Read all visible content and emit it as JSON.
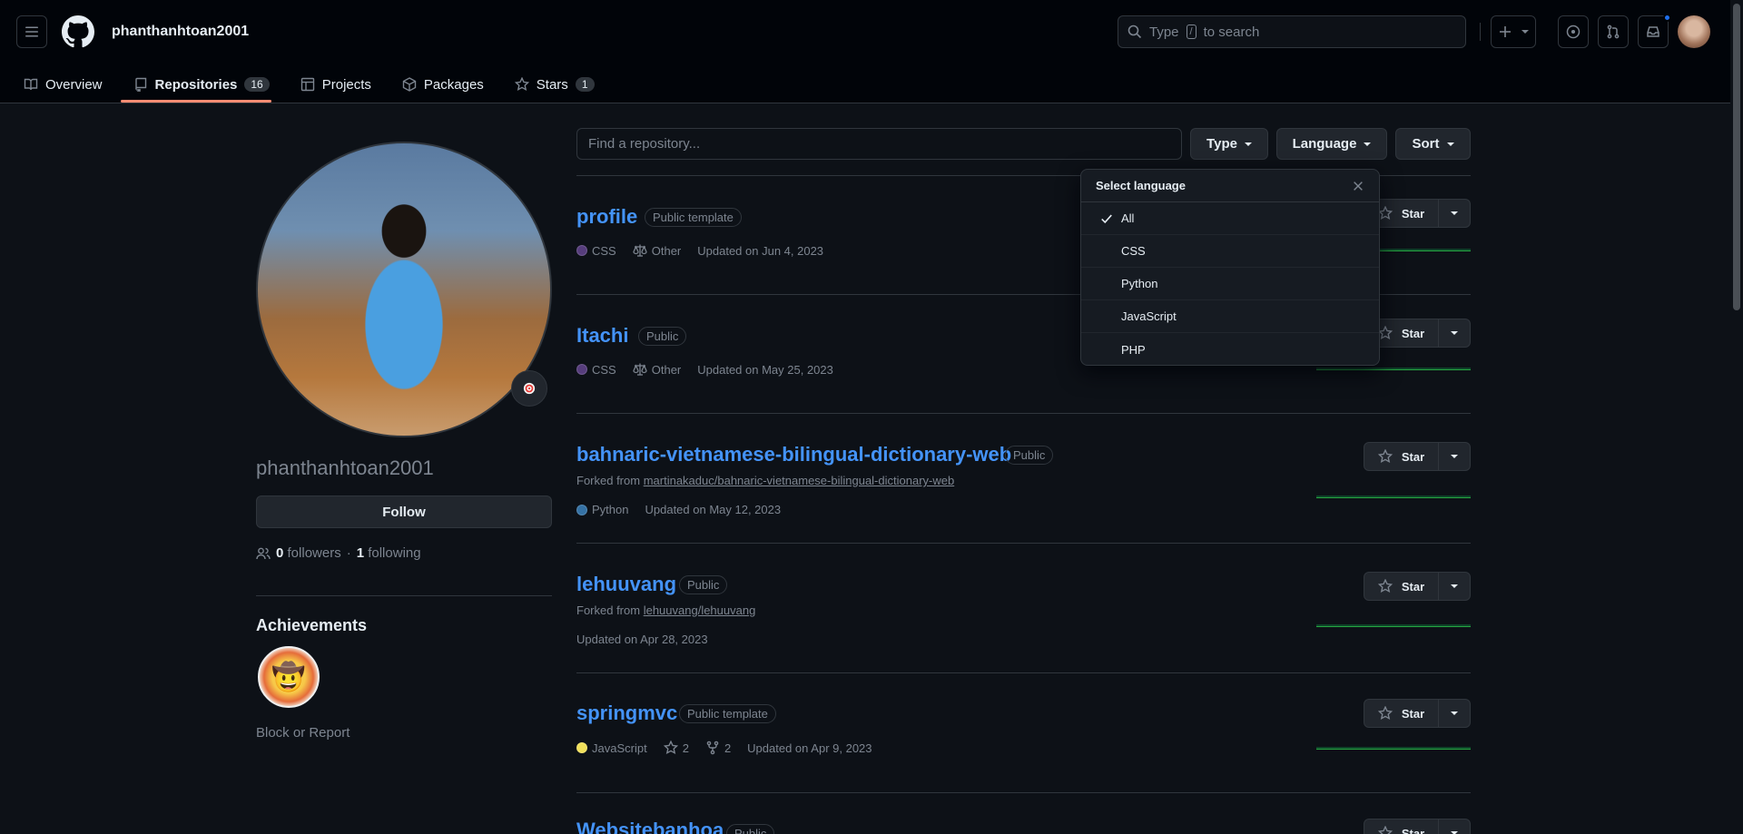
{
  "header": {
    "username": "phanthanhtoan2001",
    "search_prefix": "Type",
    "search_key": "/",
    "search_suffix": "to search"
  },
  "tabs": [
    {
      "label": "Overview",
      "icon": "book-icon"
    },
    {
      "label": "Repositories",
      "icon": "repo-icon",
      "count": "16"
    },
    {
      "label": "Projects",
      "icon": "table-icon"
    },
    {
      "label": "Packages",
      "icon": "package-icon"
    },
    {
      "label": "Stars",
      "icon": "star-icon",
      "count": "1"
    }
  ],
  "profile": {
    "name": "phanthanhtoan2001",
    "follow_label": "Follow",
    "followers_count": "0",
    "followers_label": "followers",
    "separator": "·",
    "following_count": "1",
    "following_label": "following",
    "achievements_title": "Achievements",
    "block_label": "Block or Report"
  },
  "filters": {
    "find_placeholder": "Find a repository...",
    "type_label": "Type",
    "language_label": "Language",
    "sort_label": "Sort"
  },
  "language_menu": {
    "title": "Select language",
    "options": [
      "All",
      "CSS",
      "Python",
      "JavaScript",
      "PHP"
    ],
    "selected": "All"
  },
  "repos": [
    {
      "name": "profile",
      "visibility": "Public template",
      "language": "CSS",
      "lang_color": "#563d7c",
      "license": "Other",
      "updated": "Updated on Jun 4, 2023"
    },
    {
      "name": "Itachi",
      "visibility": "Public",
      "language": "CSS",
      "lang_color": "#563d7c",
      "license": "Other",
      "updated": "Updated on May 25, 2023"
    },
    {
      "name": "bahnaric-vietnamese-bilingual-dictionary-web",
      "visibility": "Public",
      "forked_prefix": "Forked from",
      "forked_from": "martinakaduc/bahnaric-vietnamese-bilingual-dictionary-web",
      "language": "Python",
      "lang_color": "#3572a5",
      "updated": "Updated on May 12, 2023"
    },
    {
      "name": "lehuuvang",
      "visibility": "Public",
      "forked_prefix": "Forked from",
      "forked_from": "lehuuvang/lehuuvang",
      "updated": "Updated on Apr 28, 2023"
    },
    {
      "name": "springmvc",
      "visibility": "Public template",
      "language": "JavaScript",
      "lang_color": "#f1e05a",
      "stars": "2",
      "forks": "2",
      "updated": "Updated on Apr 9, 2023"
    },
    {
      "name": "Websitebanhoa",
      "visibility": "Public"
    }
  ],
  "star_label": "Star",
  "colors": {
    "accent": "#fd8c73",
    "link": "#4493f8",
    "bg": "#0d1117"
  }
}
